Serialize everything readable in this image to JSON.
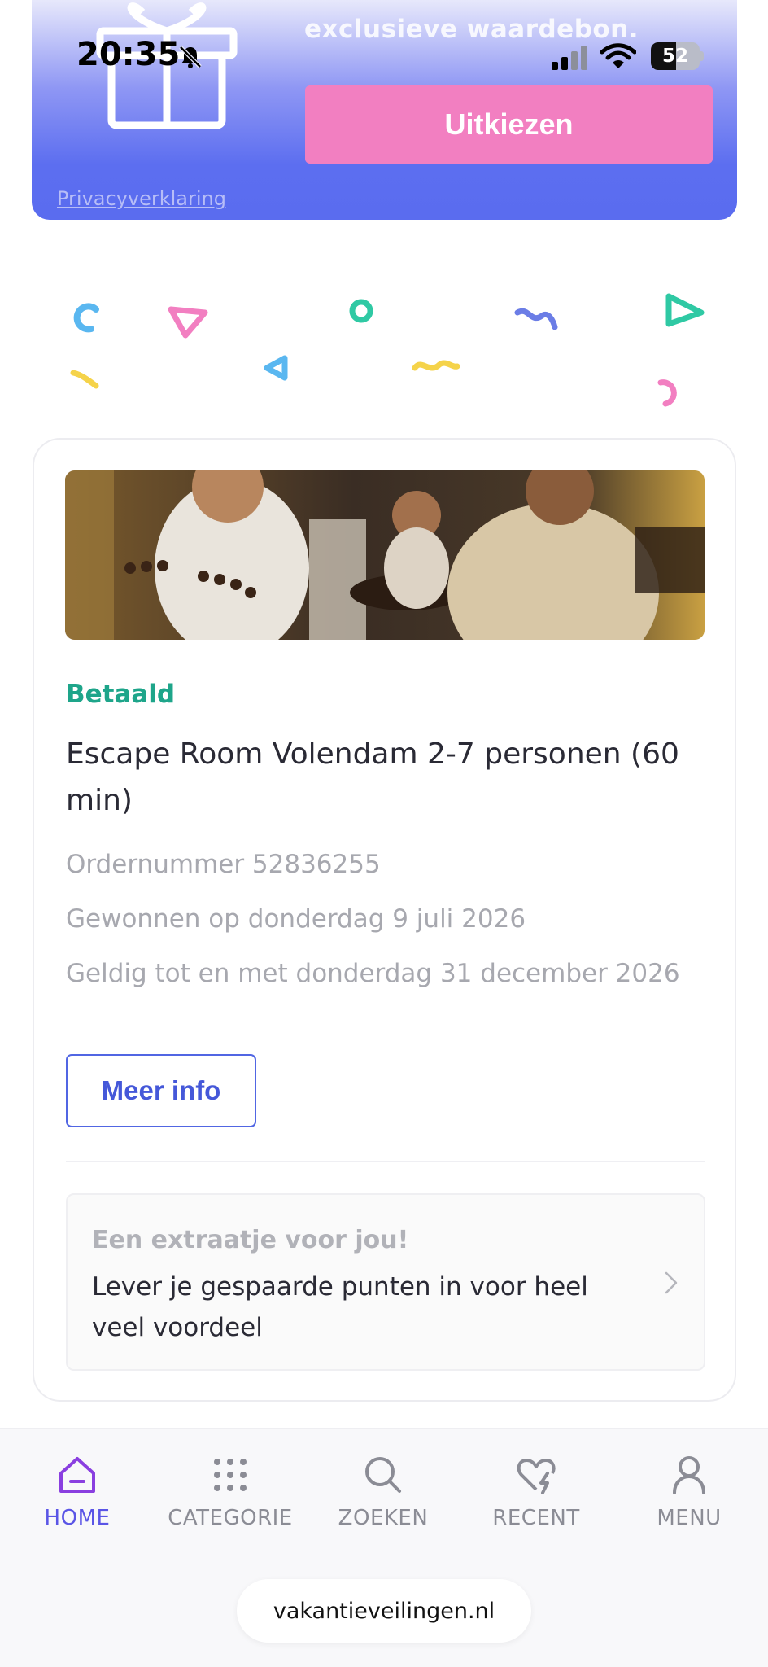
{
  "status_bar": {
    "time": "20:35",
    "battery": "52",
    "battery_fraction": 0.52
  },
  "promo": {
    "text": "exclusieve waardebon.",
    "button_label": "Uitkiezen",
    "privacy_link": "Privacyverklaring"
  },
  "card": {
    "status": "Betaald",
    "title": "Escape Room Volendam 2-7 personen (60 min)",
    "order_number": "Ordernummer 52836255",
    "won_on": "Gewonnen op donderdag 9 juli 2026",
    "valid_until": "Geldig tot en met donderdag 31 december 2026",
    "more_info_label": "Meer info",
    "extra": {
      "title": "Een extraatje voor jou!",
      "text": "Lever je gespaarde punten in voor heel veel voordeel"
    }
  },
  "bottom_nav": {
    "items": [
      {
        "label": "HOME",
        "icon": "home-icon",
        "active": true
      },
      {
        "label": "CATEGORIE",
        "icon": "grid-icon",
        "active": false
      },
      {
        "label": "ZOEKEN",
        "icon": "search-icon",
        "active": false
      },
      {
        "label": "RECENT",
        "icon": "heart-bolt-icon",
        "active": false
      },
      {
        "label": "MENU",
        "icon": "user-icon",
        "active": false
      }
    ],
    "url": "vakantieveilingen.nl"
  },
  "colors": {
    "accent": "#5a55e6",
    "paid_green": "#1ea58a",
    "button_pink": "#f27fc1",
    "banner_blue": "#5a6cef",
    "outline_blue": "#5166e3"
  }
}
